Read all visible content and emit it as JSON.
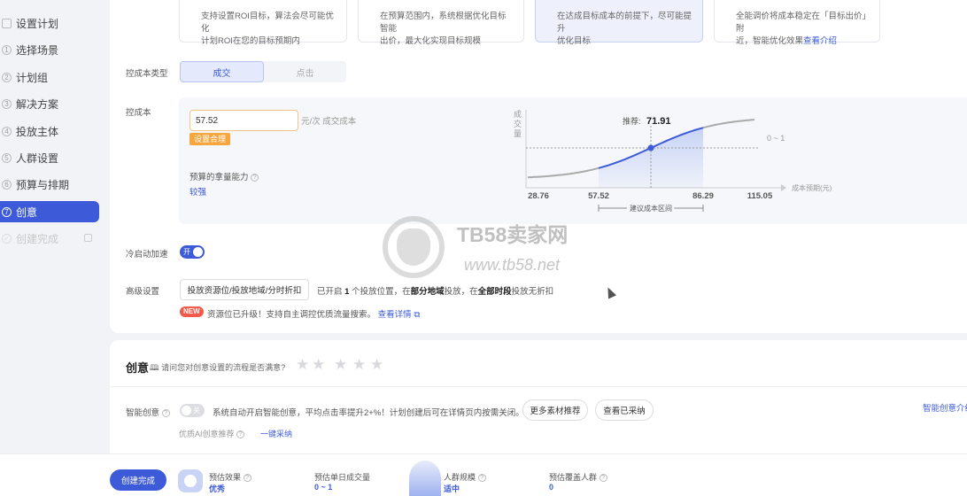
{
  "sidebar": {
    "items": [
      {
        "num": "",
        "label": "设置计划"
      },
      {
        "num": "1",
        "label": "选择场景"
      },
      {
        "num": "2",
        "label": "计划组"
      },
      {
        "num": "3",
        "label": "解决方案"
      },
      {
        "num": "4",
        "label": "投放主体"
      },
      {
        "num": "5",
        "label": "人群设置"
      },
      {
        "num": "6",
        "label": "预算与排期"
      },
      {
        "num": "7",
        "label": "创意"
      },
      {
        "num": "",
        "label": "创建完成"
      }
    ]
  },
  "options": [
    {
      "line1": "支持设置ROI目标，算法会尽可能优化",
      "line2": "计划ROI在您的目标预期内"
    },
    {
      "line1": "在预算范围内，系统根据优化目标智能",
      "line2": "出价，最大化实现目标规模"
    },
    {
      "line1": "在达成目标成本的前提下，尽可能提升",
      "line2": "优化目标"
    },
    {
      "line1": "全能调价将成本稳定在「目标出价」附",
      "line2": "近，智能优化效果",
      "link": "查看介绍"
    }
  ],
  "cost_type": {
    "label": "控成本类型",
    "tabs": [
      "成交",
      "点击"
    ]
  },
  "cost": {
    "label": "控成本",
    "value": "57.52",
    "unit": "元/次 成交成本",
    "tag": "设置合理",
    "budget_label": "预算的拿量能力",
    "budget_value": "较强"
  },
  "chart_data": {
    "type": "line",
    "ylabel": "成交量",
    "xlabel": "成本预期(元)",
    "x_ticks": [
      "28.76",
      "57.52",
      "86.29",
      "115.05"
    ],
    "recommend_label": "推荐:",
    "recommend_value": "71.91",
    "y_marker": "0 ~ 1",
    "range_label": "建议成本区间",
    "highlight_range": [
      57.52,
      86.29
    ]
  },
  "cold_start": {
    "label": "冷启动加速",
    "toggle": "开"
  },
  "advanced": {
    "label": "高级设置",
    "button": "投放资源位/投放地域/分时折扣",
    "summary_pre": "已开启",
    "summary_count": "1",
    "summary_mid": "个投放位置，在",
    "summary_region": "部分地域",
    "summary_mid2": "投放，在",
    "summary_time": "全部时段",
    "summary_post": "投放无折扣"
  },
  "notice": {
    "badge": "NEW",
    "text": "资源位已升级！支持自主调控优质流量搜索。",
    "link": "查看详情"
  },
  "creative": {
    "title": "创意",
    "survey": "请问您对创意设置的流程是否满意?",
    "smart_label": "智能创意",
    "smart_toggle": "关",
    "smart_desc": "系统自动开启智能创意，平均点击率提升2+%！计划创建后可在详情页内按需关闭。",
    "btn_more": "更多素材推荐",
    "btn_adopted": "查看已采纳",
    "right_link": "智能创意介绍",
    "ai_label": "优质AI创意推荐",
    "ai_link": "一键采纳"
  },
  "footer": {
    "create_button": "创建完成",
    "stats": [
      {
        "label": "预估效果",
        "value": "优秀"
      },
      {
        "label": "预估单日成交量",
        "value": "0 ~ 1"
      },
      {
        "label": "人群规模",
        "value": "适中"
      },
      {
        "label": "预估覆盖人群",
        "value": "0"
      }
    ]
  },
  "watermark": {
    "name": "TB58卖家网",
    "url": "www.tb58.net"
  }
}
